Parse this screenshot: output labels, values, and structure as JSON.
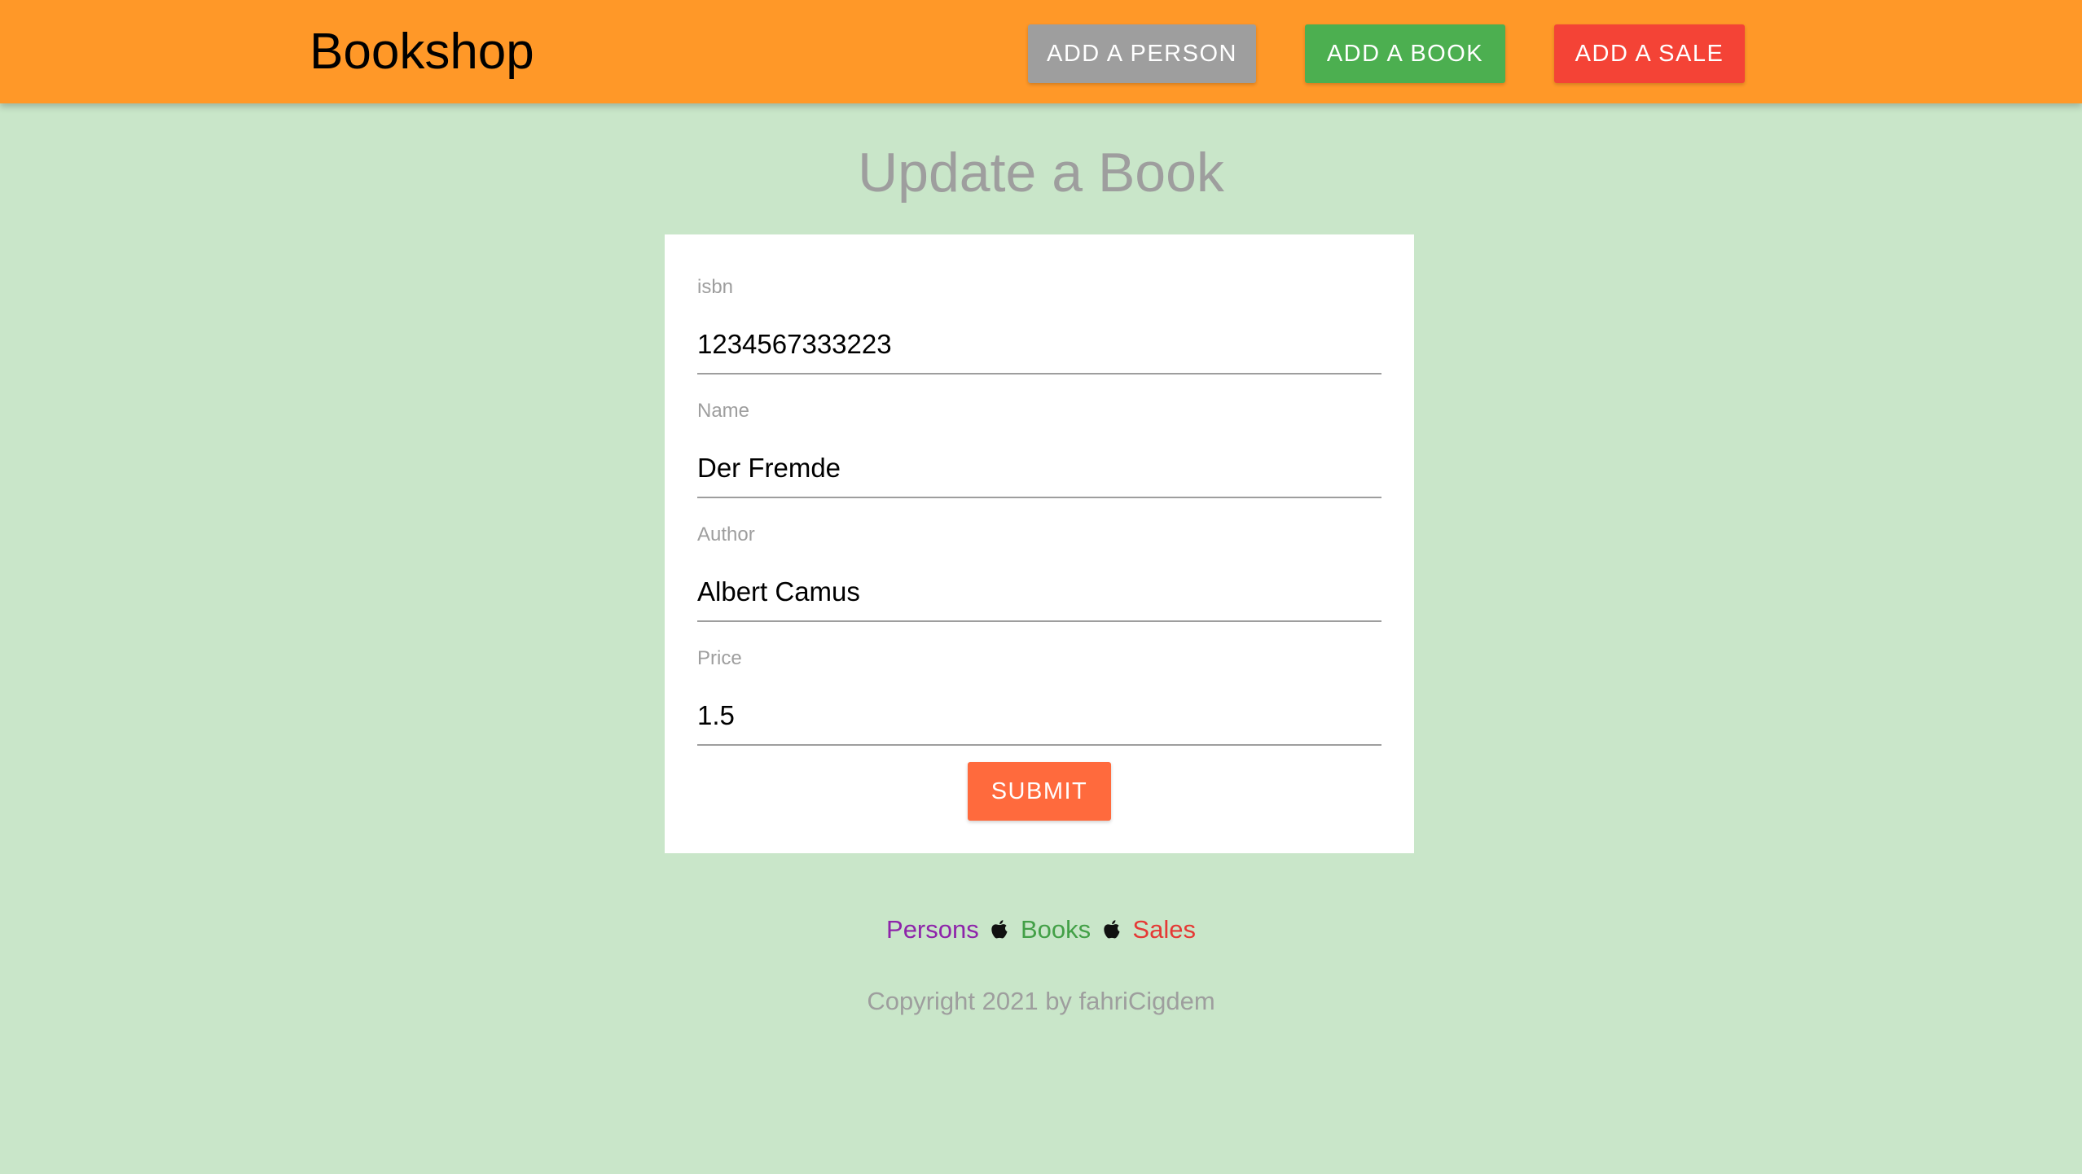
{
  "navbar": {
    "brand": "Bookshop",
    "color": "#ff9828",
    "buttons": [
      {
        "label": "ADD A PERSON",
        "color": "#9e9e9e"
      },
      {
        "label": "ADD A BOOK",
        "color": "#4caf50"
      },
      {
        "label": "ADD A SALE",
        "color": "#f44336"
      }
    ]
  },
  "page": {
    "title": "Update a Book",
    "background": "#c9e6c9"
  },
  "form": {
    "fields": [
      {
        "label": "isbn",
        "value": "1234567333223"
      },
      {
        "label": "Name",
        "value": "Der Fremde"
      },
      {
        "label": "Author",
        "value": "Albert Camus"
      },
      {
        "label": "Price",
        "value": "1.5"
      }
    ],
    "submit_label": "SUBMIT",
    "submit_color": "#ff6a3d"
  },
  "footer": {
    "links": [
      {
        "label": "Persons",
        "color": "#8e24aa"
      },
      {
        "label": "Books",
        "color": "#43a047"
      },
      {
        "label": "Sales",
        "color": "#e53935"
      }
    ],
    "separator_icon": "apple-icon",
    "copyright": "Copyright 2021 by fahriCigdem"
  }
}
